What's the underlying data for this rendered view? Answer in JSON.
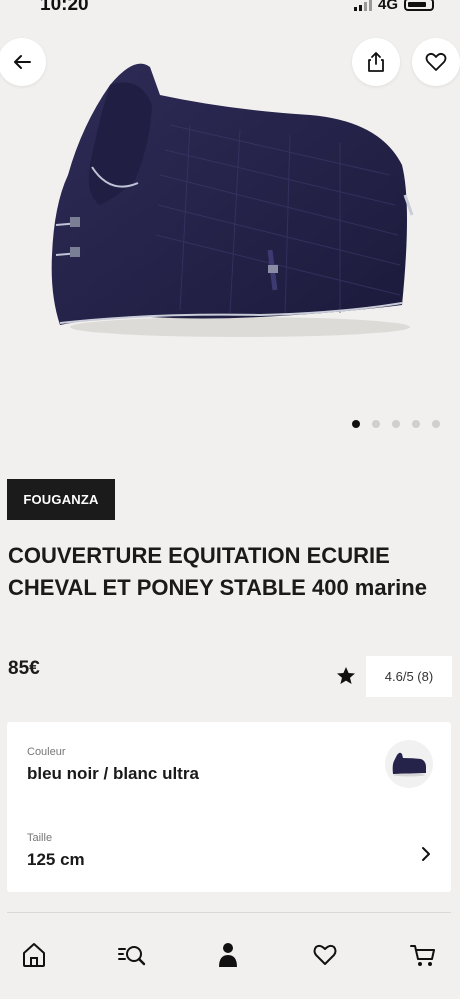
{
  "status_bar": {
    "time": "10:20",
    "network": "4G"
  },
  "top_actions": {
    "back_icon": "arrow-left-icon",
    "share_icon": "share-icon",
    "favorite_icon": "heart-icon"
  },
  "gallery": {
    "total_images": 5,
    "active_index": 0
  },
  "product": {
    "brand": "FOUGANZA",
    "title": "COUVERTURE EQUITATION ECURIE CHEVAL ET PONEY STABLE 400 marine",
    "price": "85€",
    "rating": "4.6/5 (8)"
  },
  "options": {
    "color_label": "Couleur",
    "color_value": "bleu noir / blanc ultra",
    "size_label": "Taille",
    "size_value": "125 cm"
  },
  "bottom_nav": {
    "items": [
      "home-icon",
      "search-icon",
      "account-icon",
      "wishlist-icon",
      "cart-icon"
    ]
  },
  "colors": {
    "background": "#f1f0ee",
    "card": "#ffffff",
    "badge": "#1b1b1b",
    "blanket": "#25234a"
  }
}
